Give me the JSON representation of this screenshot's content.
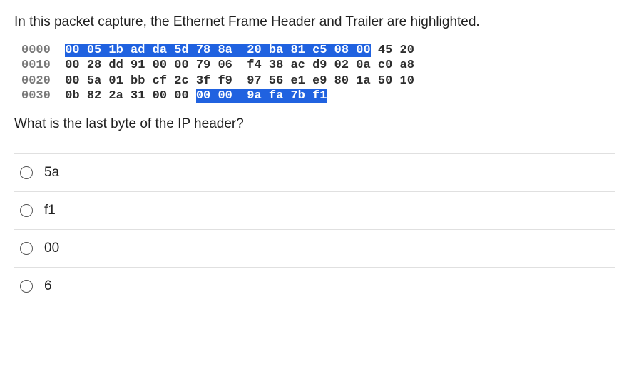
{
  "question_intro": "In this packet capture, the Ethernet Frame Header and Trailer are highlighted.",
  "hex": {
    "rows": [
      {
        "offset": "0000",
        "segs": [
          {
            "t": "  ",
            "c": "plain"
          },
          {
            "t": "00 05 1b ad da 5d 78 8a  20 ba 81 c5 08 00",
            "c": "hl"
          },
          {
            "t": " 45 20",
            "c": "plain"
          }
        ]
      },
      {
        "offset": "0010",
        "segs": [
          {
            "t": "  00 28 dd 91 00 00 79 06  f4 38 ac d9 02 0a c0 a8",
            "c": "plain"
          }
        ]
      },
      {
        "offset": "0020",
        "segs": [
          {
            "t": "  00 5a 01 bb cf 2c 3f f9  97 56 e1 e9 80 1a 50 10",
            "c": "plain"
          }
        ]
      },
      {
        "offset": "0030",
        "segs": [
          {
            "t": "  0b 82 2a 31 00 00 ",
            "c": "plain"
          },
          {
            "t": "00 00  9a fa 7b f1",
            "c": "hl"
          }
        ]
      }
    ]
  },
  "subquestion": "What is the last byte of the IP header?",
  "options": [
    "5a",
    "f1",
    "00",
    "6"
  ]
}
